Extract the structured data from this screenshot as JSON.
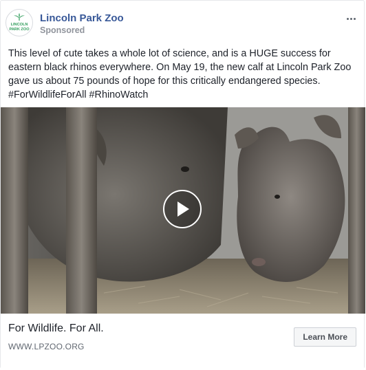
{
  "post": {
    "page_name": "Lincoln Park Zoo",
    "sponsored_label": "Sponsored",
    "avatar_logo_text_line1": "LINCOLN",
    "avatar_logo_text_line2": "PARK ZOO",
    "more_icon": "ellipsis-icon",
    "message": "This level of cute takes a whole lot of science, and is a HUGE success for eastern black rhinos everywhere. On May 19, the new calf at Lincoln Park Zoo gave us about 75 pounds of hope for this critically endangered species. #ForWildlifeForAll #RhinoWatch"
  },
  "media": {
    "type": "video",
    "play_icon": "play-icon"
  },
  "link": {
    "headline": "For Wildlife. For All.",
    "domain": "WWW.LPZOO.ORG",
    "cta_label": "Learn More"
  },
  "colors": {
    "page_name": "#385898",
    "secondary_text": "#90949c",
    "logo_green": "#2e8b57"
  }
}
